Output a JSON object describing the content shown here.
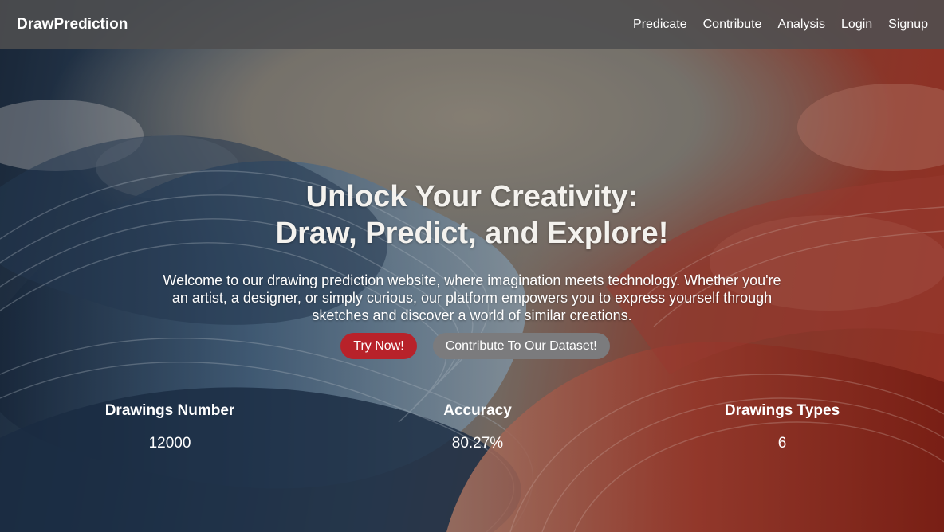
{
  "navbar": {
    "brand": "DrawPrediction",
    "links": [
      "Predicate",
      "Contribute",
      "Analysis",
      "Login",
      "Signup"
    ]
  },
  "hero": {
    "title_line1": "Unlock Your Creativity:",
    "title_line2": "Draw, Predict, and Explore!",
    "description": "Welcome to our drawing prediction website, where imagination meets technology. Whether you're an artist, a designer, or simply curious, our platform empowers you to express yourself through sketches and discover a world of similar creations.",
    "primary_button": "Try Now!",
    "secondary_button": "Contribute To Our Dataset!"
  },
  "stats": [
    {
      "label": "Drawings Number",
      "value": "12000"
    },
    {
      "label": "Accuracy",
      "value": "80.27%"
    },
    {
      "label": "Drawings Types",
      "value": "6"
    }
  ],
  "colors": {
    "navbar_bg": "#4e4e50",
    "primary_button": "#b8222a",
    "secondary_button": "#7b7b7d",
    "text": "#ffffff"
  }
}
